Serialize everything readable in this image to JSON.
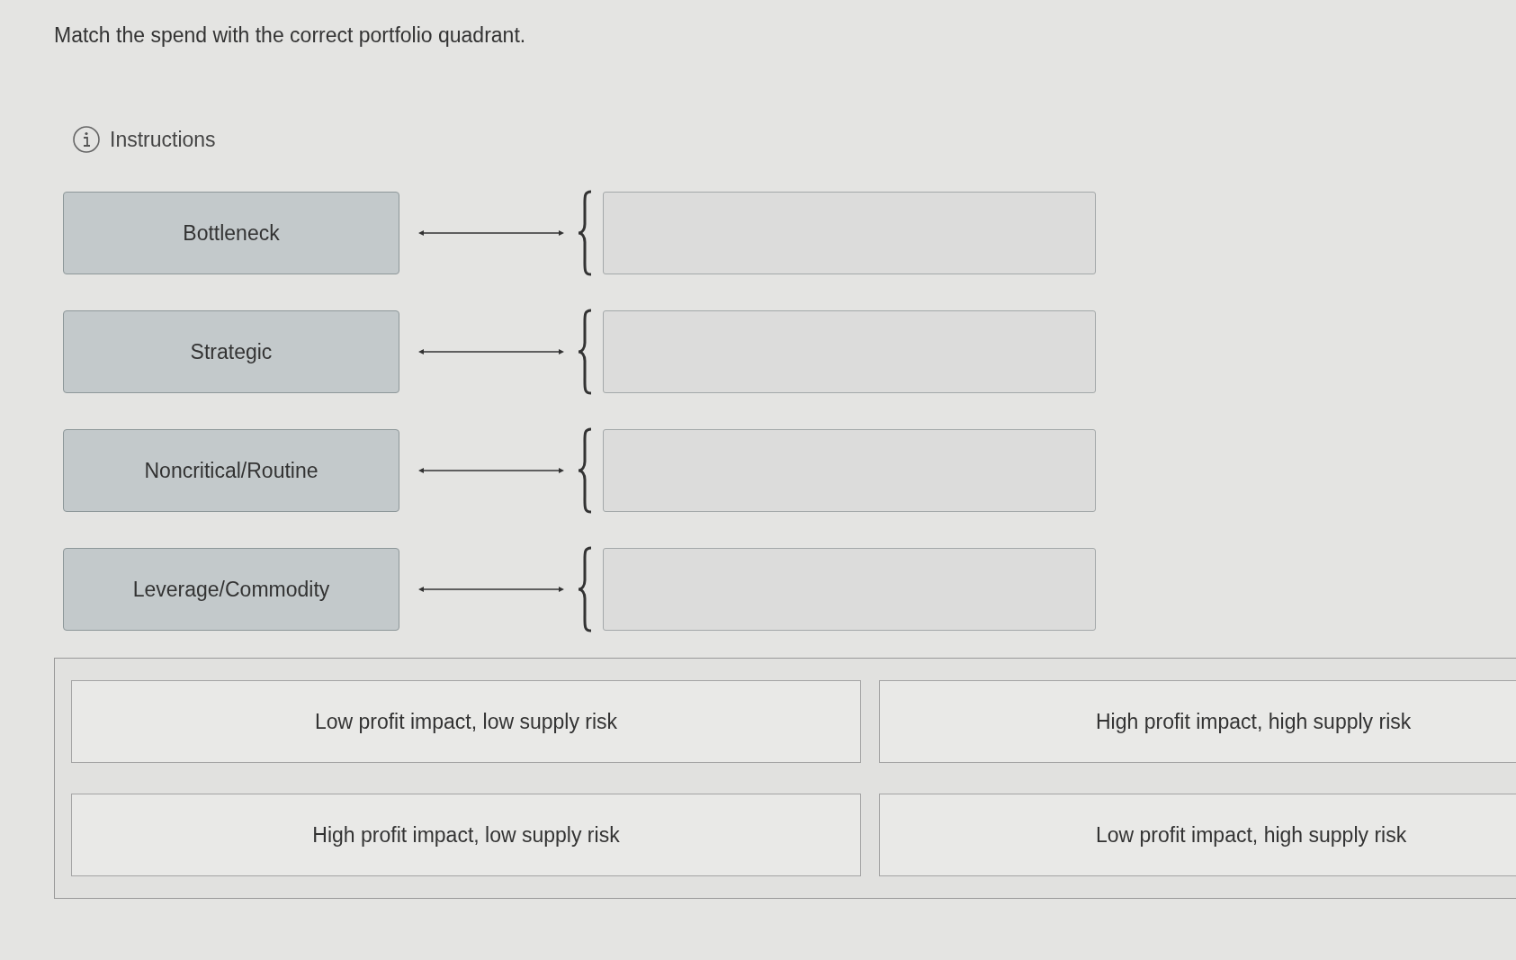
{
  "prompt": "Match the spend with the correct portfolio quadrant.",
  "instructions": {
    "label": "Instructions"
  },
  "pairs": [
    {
      "label": "Bottleneck"
    },
    {
      "label": "Strategic"
    },
    {
      "label": "Noncritical/Routine"
    },
    {
      "label": "Leverage/Commodity"
    }
  ],
  "options": [
    {
      "text": "Low profit impact, low supply risk"
    },
    {
      "text": "High profit impact, high supply risk"
    },
    {
      "text": "High profit impact, low supply risk"
    },
    {
      "text": "Low profit impact, high supply risk"
    }
  ]
}
